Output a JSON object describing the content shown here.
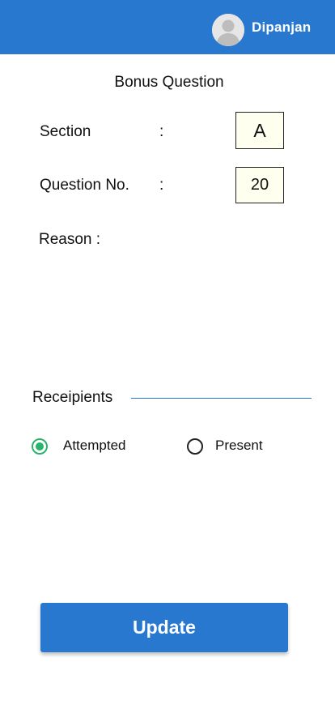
{
  "header": {
    "username": "Dipanjan",
    "background_color": "#2878cf"
  },
  "page_title": "Bonus Question",
  "form": {
    "section_label": "Section",
    "section_value": "A",
    "question_label": "Question No.",
    "question_value": "20",
    "separator": ":",
    "reason_label": "Reason :"
  },
  "recipients": {
    "label": "Receipients",
    "options": [
      {
        "label": "Attempted",
        "selected": true
      },
      {
        "label": "Present",
        "selected": false
      }
    ],
    "selected_color": "#2bb36b"
  },
  "actions": {
    "update_label": "Update"
  }
}
